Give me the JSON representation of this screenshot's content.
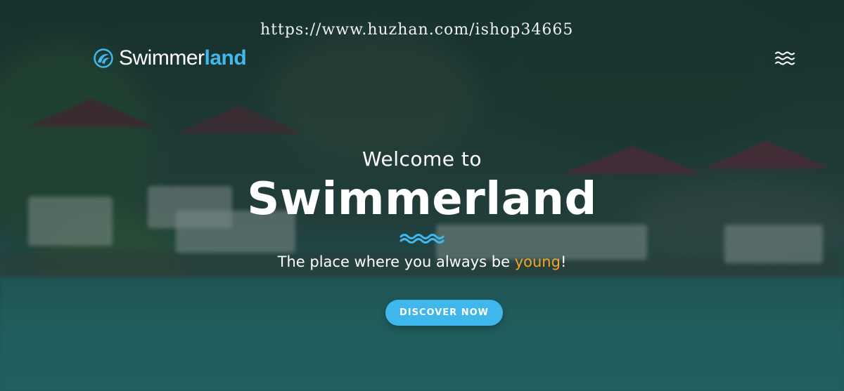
{
  "watermark": "https://www.huzhan.com/ishop34665",
  "header": {
    "logo_plain": "Swimmer",
    "logo_accent": "land",
    "logo_icon": "wave-circle-icon",
    "menu_icon": "waves-menu-icon"
  },
  "hero": {
    "welcome": "Welcome to",
    "title": "Swimmerland",
    "tagline_before": "The place where you always be ",
    "tagline_highlight": "young",
    "tagline_after": "!",
    "cta_label": "DISCOVER NOW"
  },
  "colors": {
    "accent": "#41b8ee",
    "highlight": "#f5a32a",
    "button": "#3fb6ec"
  }
}
